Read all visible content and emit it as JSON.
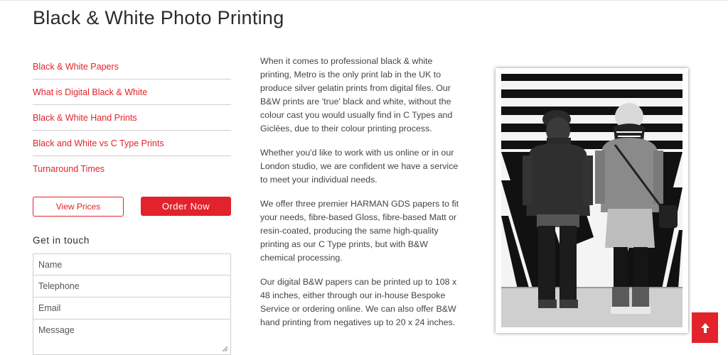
{
  "page": {
    "title": "Black & White Photo Printing"
  },
  "sidebar": {
    "items": [
      {
        "label": "Black & White Papers"
      },
      {
        "label": "What is Digital Black & White"
      },
      {
        "label": "Black & White Hand Prints"
      },
      {
        "label": "Black and White vs C Type Prints"
      },
      {
        "label": "Turnaround Times"
      }
    ],
    "view_prices_label": "View Prices",
    "order_now_label": "Order Now"
  },
  "contact": {
    "heading": "Get in touch",
    "name_placeholder": "Name",
    "telephone_placeholder": "Telephone",
    "email_placeholder": "Email",
    "message_placeholder": "Message"
  },
  "content": {
    "paragraphs": [
      "When it comes to professional black & white printing, Metro is the only print lab in the UK to produce silver gelatin prints from digital files. Our B&W prints are 'true' black and white, without the colour cast you would usually find in C Types and Giclées, due to their colour printing process.",
      "Whether you'd like to work with us online or in our London studio, we are confident we have a service to meet your individual needs.",
      "We offer three premier HARMAN GDS papers to fit your needs, fibre-based Gloss, fibre-based Matt or resin-coated, producing the same high-quality printing as our C Type prints, but with B&W chemical processing.",
      "Our digital B&W papers can be printed up to 108 x 48 inches, either through our in-house Bespoke Service or ordering online. We can also offer B&W hand printing from negatives up to 20 x 24 inches."
    ]
  },
  "colors": {
    "accent": "#e2232b"
  },
  "icons": {
    "scroll_top": "arrow-up-icon"
  }
}
